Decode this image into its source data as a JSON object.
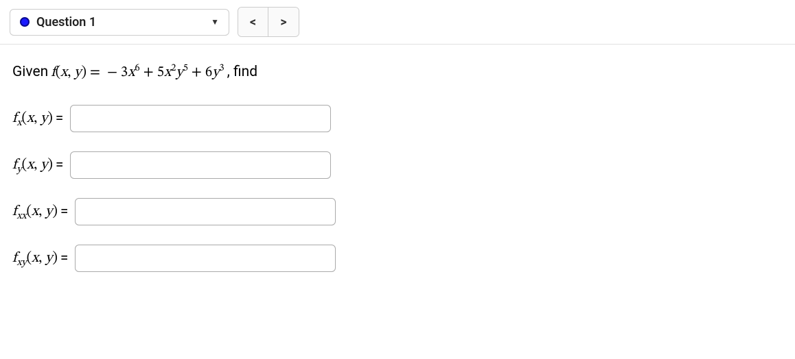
{
  "toolbar": {
    "question_label": "Question 1",
    "prev_symbol": "<",
    "next_symbol": ">"
  },
  "problem": {
    "given_prefix": "Given",
    "func_lhs_html": "<span class='math'>f<span class='rm'>(</span>x<span class='rm'>,</span> y<span class='rm'>)</span> <span class='rm'>=</span> <span class='rm'>&nbsp;&minus;&nbsp;3</span>x<sup>6</sup> <span class='rm'>+ 5</span>x<sup>2</sup>y<sup>5</sup> <span class='rm'>+ 6</span>y<sup>3</sup></span>",
    "given_suffix": ", find"
  },
  "rows": [
    {
      "label_html": "<span class='math'>f<sub>x</sub><span class='rm'>(</span>x<span class='rm'>,</span> y<span class='rm'>)</span></span>",
      "value": ""
    },
    {
      "label_html": "<span class='math'>f<sub>y</sub><span class='rm'>(</span>x<span class='rm'>,</span> y<span class='rm'>)</span></span>",
      "value": ""
    },
    {
      "label_html": "<span class='math'>f<sub>xx</sub><span class='rm'>(</span>x<span class='rm'>,</span> y<span class='rm'>)</span></span>",
      "value": ""
    },
    {
      "label_html": "<span class='math'>f<sub>xy</sub><span class='rm'>(</span>x<span class='rm'>,</span> y<span class='rm'>)</span></span>",
      "value": ""
    }
  ],
  "eq_symbol": "="
}
